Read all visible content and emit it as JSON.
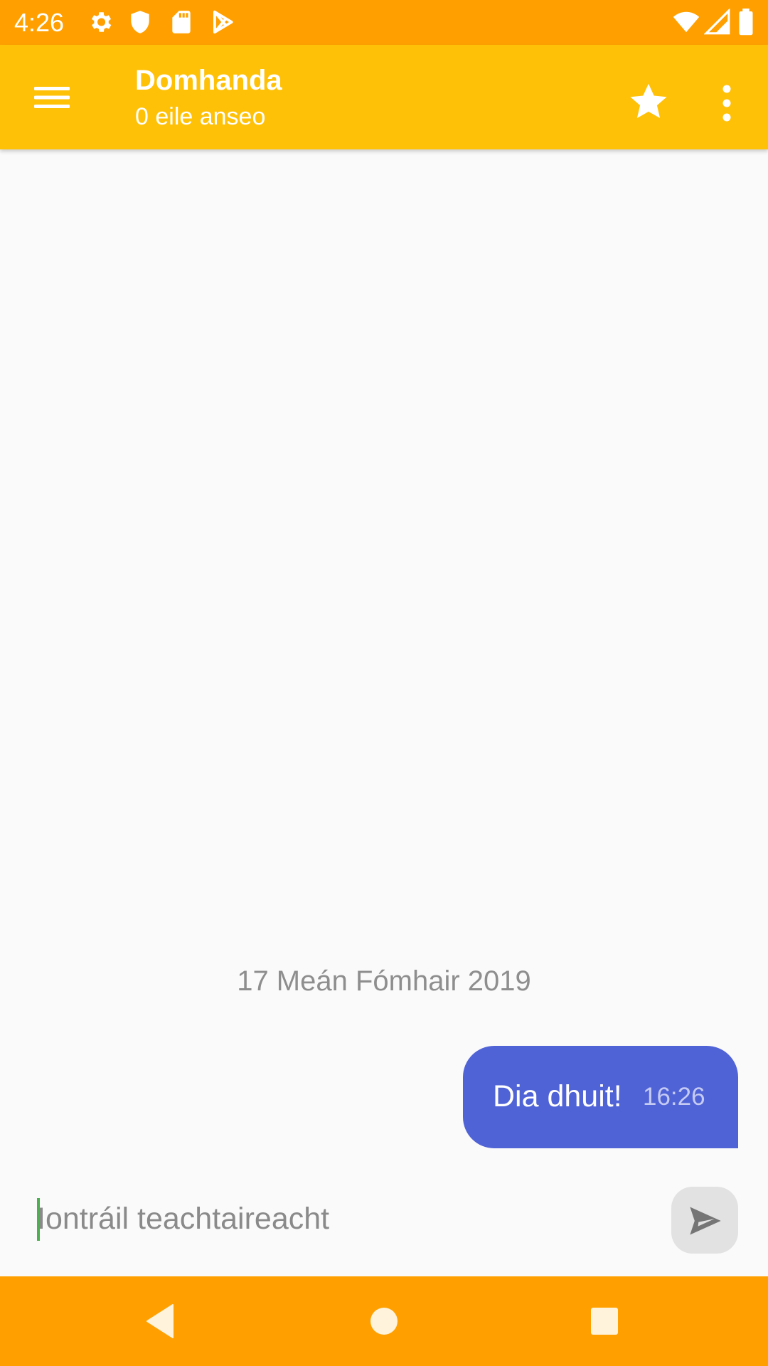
{
  "status_bar": {
    "time": "4:26",
    "icons": [
      "settings-icon",
      "shield-icon",
      "sd-card-icon",
      "play-store-icon",
      "wifi-icon",
      "signal-icon",
      "battery-icon"
    ],
    "color": "#FFA000"
  },
  "app_bar": {
    "title": "Domhanda",
    "subtitle": "0 eile anseo",
    "color": "#FFC107",
    "icons": [
      "menu-icon",
      "star-icon",
      "more-vert-icon"
    ]
  },
  "chat": {
    "date_divider": "17 Meán Fómhair 2019",
    "messages": [
      {
        "text": "Dia dhuit!",
        "time": "16:26",
        "outgoing": true,
        "bubble_color": "#5063D6"
      }
    ]
  },
  "composer": {
    "placeholder": "Iontráil teachtaireacht",
    "value": "",
    "send_icon": "send-icon",
    "cursor_color": "#4CAF50"
  },
  "nav_bar": {
    "color": "#FFA000",
    "icons": [
      "back-icon",
      "home-icon",
      "recents-icon"
    ]
  }
}
